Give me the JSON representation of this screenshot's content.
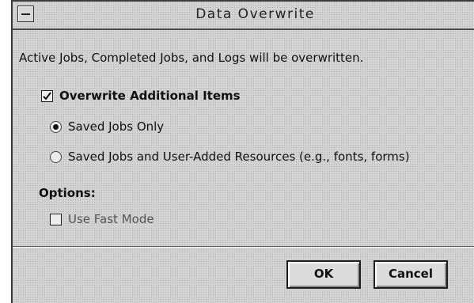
{
  "window": {
    "title": "Data Overwrite",
    "system_menu_icon": "window-menu-icon"
  },
  "description": "Active Jobs, Completed Jobs, and Logs will be overwritten.",
  "overwrite_additional": {
    "label": "Overwrite Additional Items",
    "checked": true,
    "options": [
      {
        "label": "Saved Jobs Only",
        "selected": true
      },
      {
        "label": "Saved Jobs and User-Added Resources (e.g., fonts, forms)",
        "selected": false
      }
    ]
  },
  "options_section": {
    "heading": "Options:",
    "fast_mode": {
      "label": "Use Fast Mode",
      "checked": false
    }
  },
  "buttons": {
    "ok": "OK",
    "cancel": "Cancel"
  }
}
